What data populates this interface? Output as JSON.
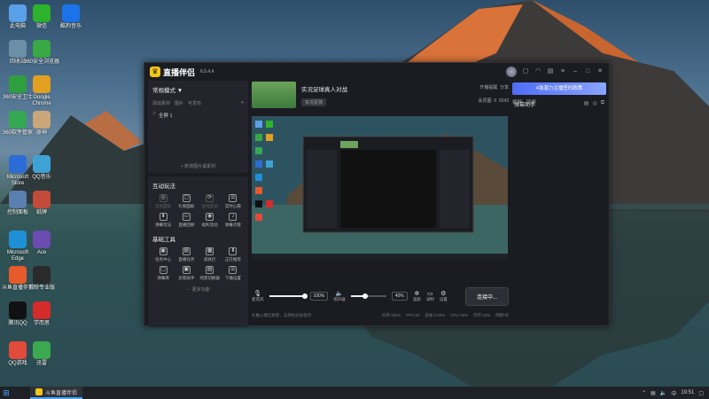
{
  "desktop": {
    "icons": [
      {
        "label": "此电脑",
        "color": "#5aa0e6"
      },
      {
        "label": "微信",
        "color": "#2bb32b"
      },
      {
        "label": "酷狗音乐",
        "color": "#1a73e8"
      },
      {
        "label": "回收站",
        "color": "#6b8fa5"
      },
      {
        "label": "360安全浏览器",
        "color": "#3aa845"
      },
      {
        "label": "360安全卫士",
        "color": "#2e9e3e"
      },
      {
        "label": "Google Chrome",
        "color": "#e2a021"
      },
      {
        "label": "360软件管家",
        "color": "#35a853"
      },
      {
        "label": "原神",
        "color": "#c9a77a"
      },
      {
        "label": "Microsoft Store",
        "color": "#2b6cd6"
      },
      {
        "label": "QQ音乐",
        "color": "#3fa2d6"
      },
      {
        "label": "控制面板",
        "color": "#5a7fb0"
      },
      {
        "label": "纸牌",
        "color": "#c24b3a"
      },
      {
        "label": "Microsoft Edge",
        "color": "#1f8fd6"
      },
      {
        "label": "Ace",
        "color": "#6a4bb0"
      },
      {
        "label": "斗鱼直播伴侣",
        "color": "#e65a2b"
      },
      {
        "label": "剪映专业版",
        "color": "#2a2a2a"
      },
      {
        "label": "腾讯QQ",
        "color": "#111"
      },
      {
        "label": "学而思",
        "color": "#d62b2b"
      },
      {
        "label": "QQ游戏",
        "color": "#e24a3b"
      },
      {
        "label": "迅雷",
        "color": "#3ca84f"
      }
    ]
  },
  "app": {
    "name": "直播伴侣",
    "version": "6.5.4.4",
    "left": {
      "mode_label": "常规模式 ▼",
      "mode_links": [
        "横屏",
        "竖屏"
      ],
      "scene_tabs": [
        "添加素材",
        "图片",
        "可发布"
      ],
      "scene_item": "全屏 1",
      "add_scene": "+ 新增图片或素材",
      "interact_title": "互动玩法",
      "interact": [
        {
          "label": "信息面板",
          "icon": "◎",
          "dim": true
        },
        {
          "label": "礼物面板",
          "icon": "▢",
          "dim": false
        },
        {
          "label": "连线互动",
          "icon": "⟳",
          "dim": true
        },
        {
          "label": "实时心愿",
          "icon": "☰",
          "dim": false
        },
        {
          "label": "弹幕玩法",
          "icon": "⬇",
          "dim": false
        },
        {
          "label": "直播回顾",
          "icon": "▭",
          "dim": false
        },
        {
          "label": "福利活动",
          "icon": "◉",
          "dim": false
        },
        {
          "label": "弹幕点歌",
          "icon": "♪",
          "dim": false
        }
      ],
      "tools_title": "基础工具",
      "tools": [
        {
          "label": "任务中心",
          "icon": "▣"
        },
        {
          "label": "直播任务",
          "icon": "▤"
        },
        {
          "label": "道具栏",
          "icon": "▦"
        },
        {
          "label": "正在推荐",
          "icon": "⬇"
        },
        {
          "label": "弹幕库",
          "icon": "▢"
        },
        {
          "label": "房管助手",
          "icon": "▣"
        },
        {
          "label": "场景切换器",
          "icon": "▤"
        },
        {
          "label": "下播设置",
          "icon": "☰"
        }
      ],
      "more": "··· 更多功能"
    },
    "room": {
      "title": "实况足球真人对战",
      "tag": "实况足球",
      "links": [
        "开播提醒",
        "分享"
      ],
      "stats": [
        "会员图",
        "0",
        "9243"
      ]
    },
    "controls": {
      "mic_label": "麦克风",
      "mic_pct": "100%",
      "mic_level": 1.0,
      "speaker_label": "扬声器",
      "speaker_pct": "40%",
      "speaker_level": 0.4,
      "icons": [
        "美颜",
        "录制",
        "设置"
      ],
      "live_button": "连接中..."
    },
    "status": [
      "扎推心跳已更新，支持标达标提示",
      "码率:0kb/s",
      "FPS:30",
      "丢帧:0.00%",
      "CPU:78%",
      "内存:23%",
      "网络:好"
    ],
    "right": {
      "banner": "4强潜力主播签约政策",
      "title": "弹幕助手"
    }
  },
  "taskbar": {
    "app_label": "斗鱼直播伴侣",
    "time": "19:51",
    "lang": "中"
  }
}
